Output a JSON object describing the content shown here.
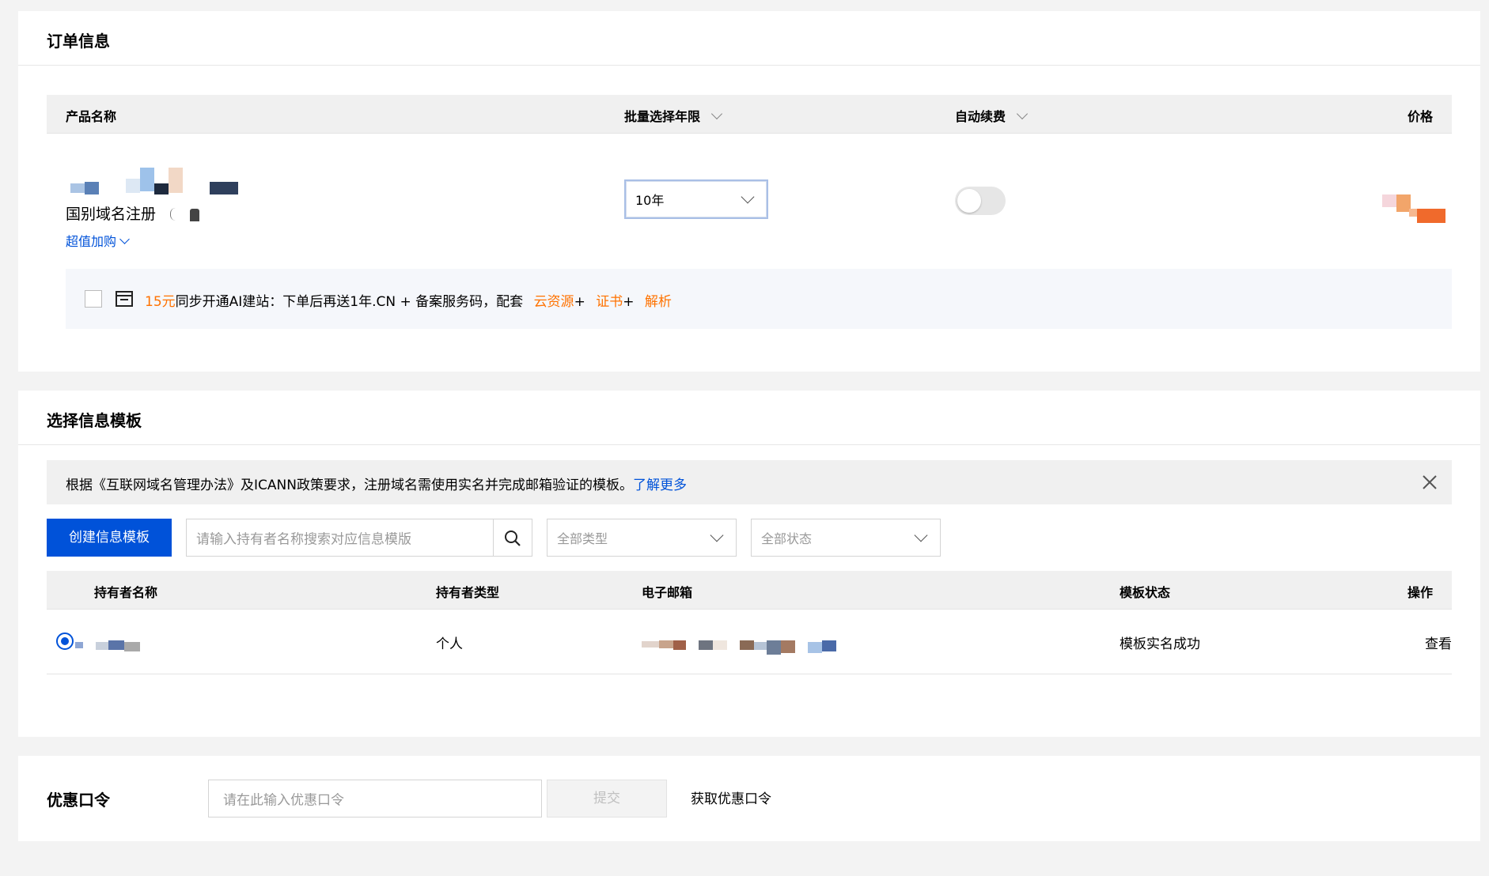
{
  "order": {
    "title": "订单信息",
    "columns": {
      "product": "产品名称",
      "term": "批量选择年限",
      "auto_renew": "自动续费",
      "price": "价格"
    },
    "item": {
      "name": "国别域名注册",
      "upsell_label": "超值加购",
      "term_value": "10年",
      "auto_renew_on": false
    },
    "promo": {
      "checked": false,
      "price": "15元",
      "text": "同步开通AI建站：下单后再送1年.CN + 备案服务码，配套",
      "res1": "云资源",
      "plus1": "+",
      "res2": "证书",
      "plus2": "+",
      "res3": "解析"
    }
  },
  "template": {
    "title": "选择信息模板",
    "notice": "根据《互联网域名管理办法》及ICANN政策要求，注册域名需使用实名并完成邮箱验证的模板。",
    "notice_link": "了解更多",
    "create_button": "创建信息模板",
    "search_placeholder": "请输入持有者名称搜索对应信息模版",
    "type_filter": "全部类型",
    "status_filter": "全部状态",
    "columns": {
      "holder": "持有者名称",
      "holder_type": "持有者类型",
      "email": "电子邮箱",
      "status": "模板状态",
      "action": "操作"
    },
    "rows": [
      {
        "selected": true,
        "holder_type": "个人",
        "status": "模板实名成功",
        "action": "查看"
      }
    ]
  },
  "coupon": {
    "title": "优惠口令",
    "placeholder": "请在此输入优惠口令",
    "submit": "提交",
    "get_link": "获取优惠口令"
  },
  "colors": {
    "primary": "#0052d9",
    "accent_orange": "#ff7200",
    "page_bg": "#f3f3f3"
  }
}
